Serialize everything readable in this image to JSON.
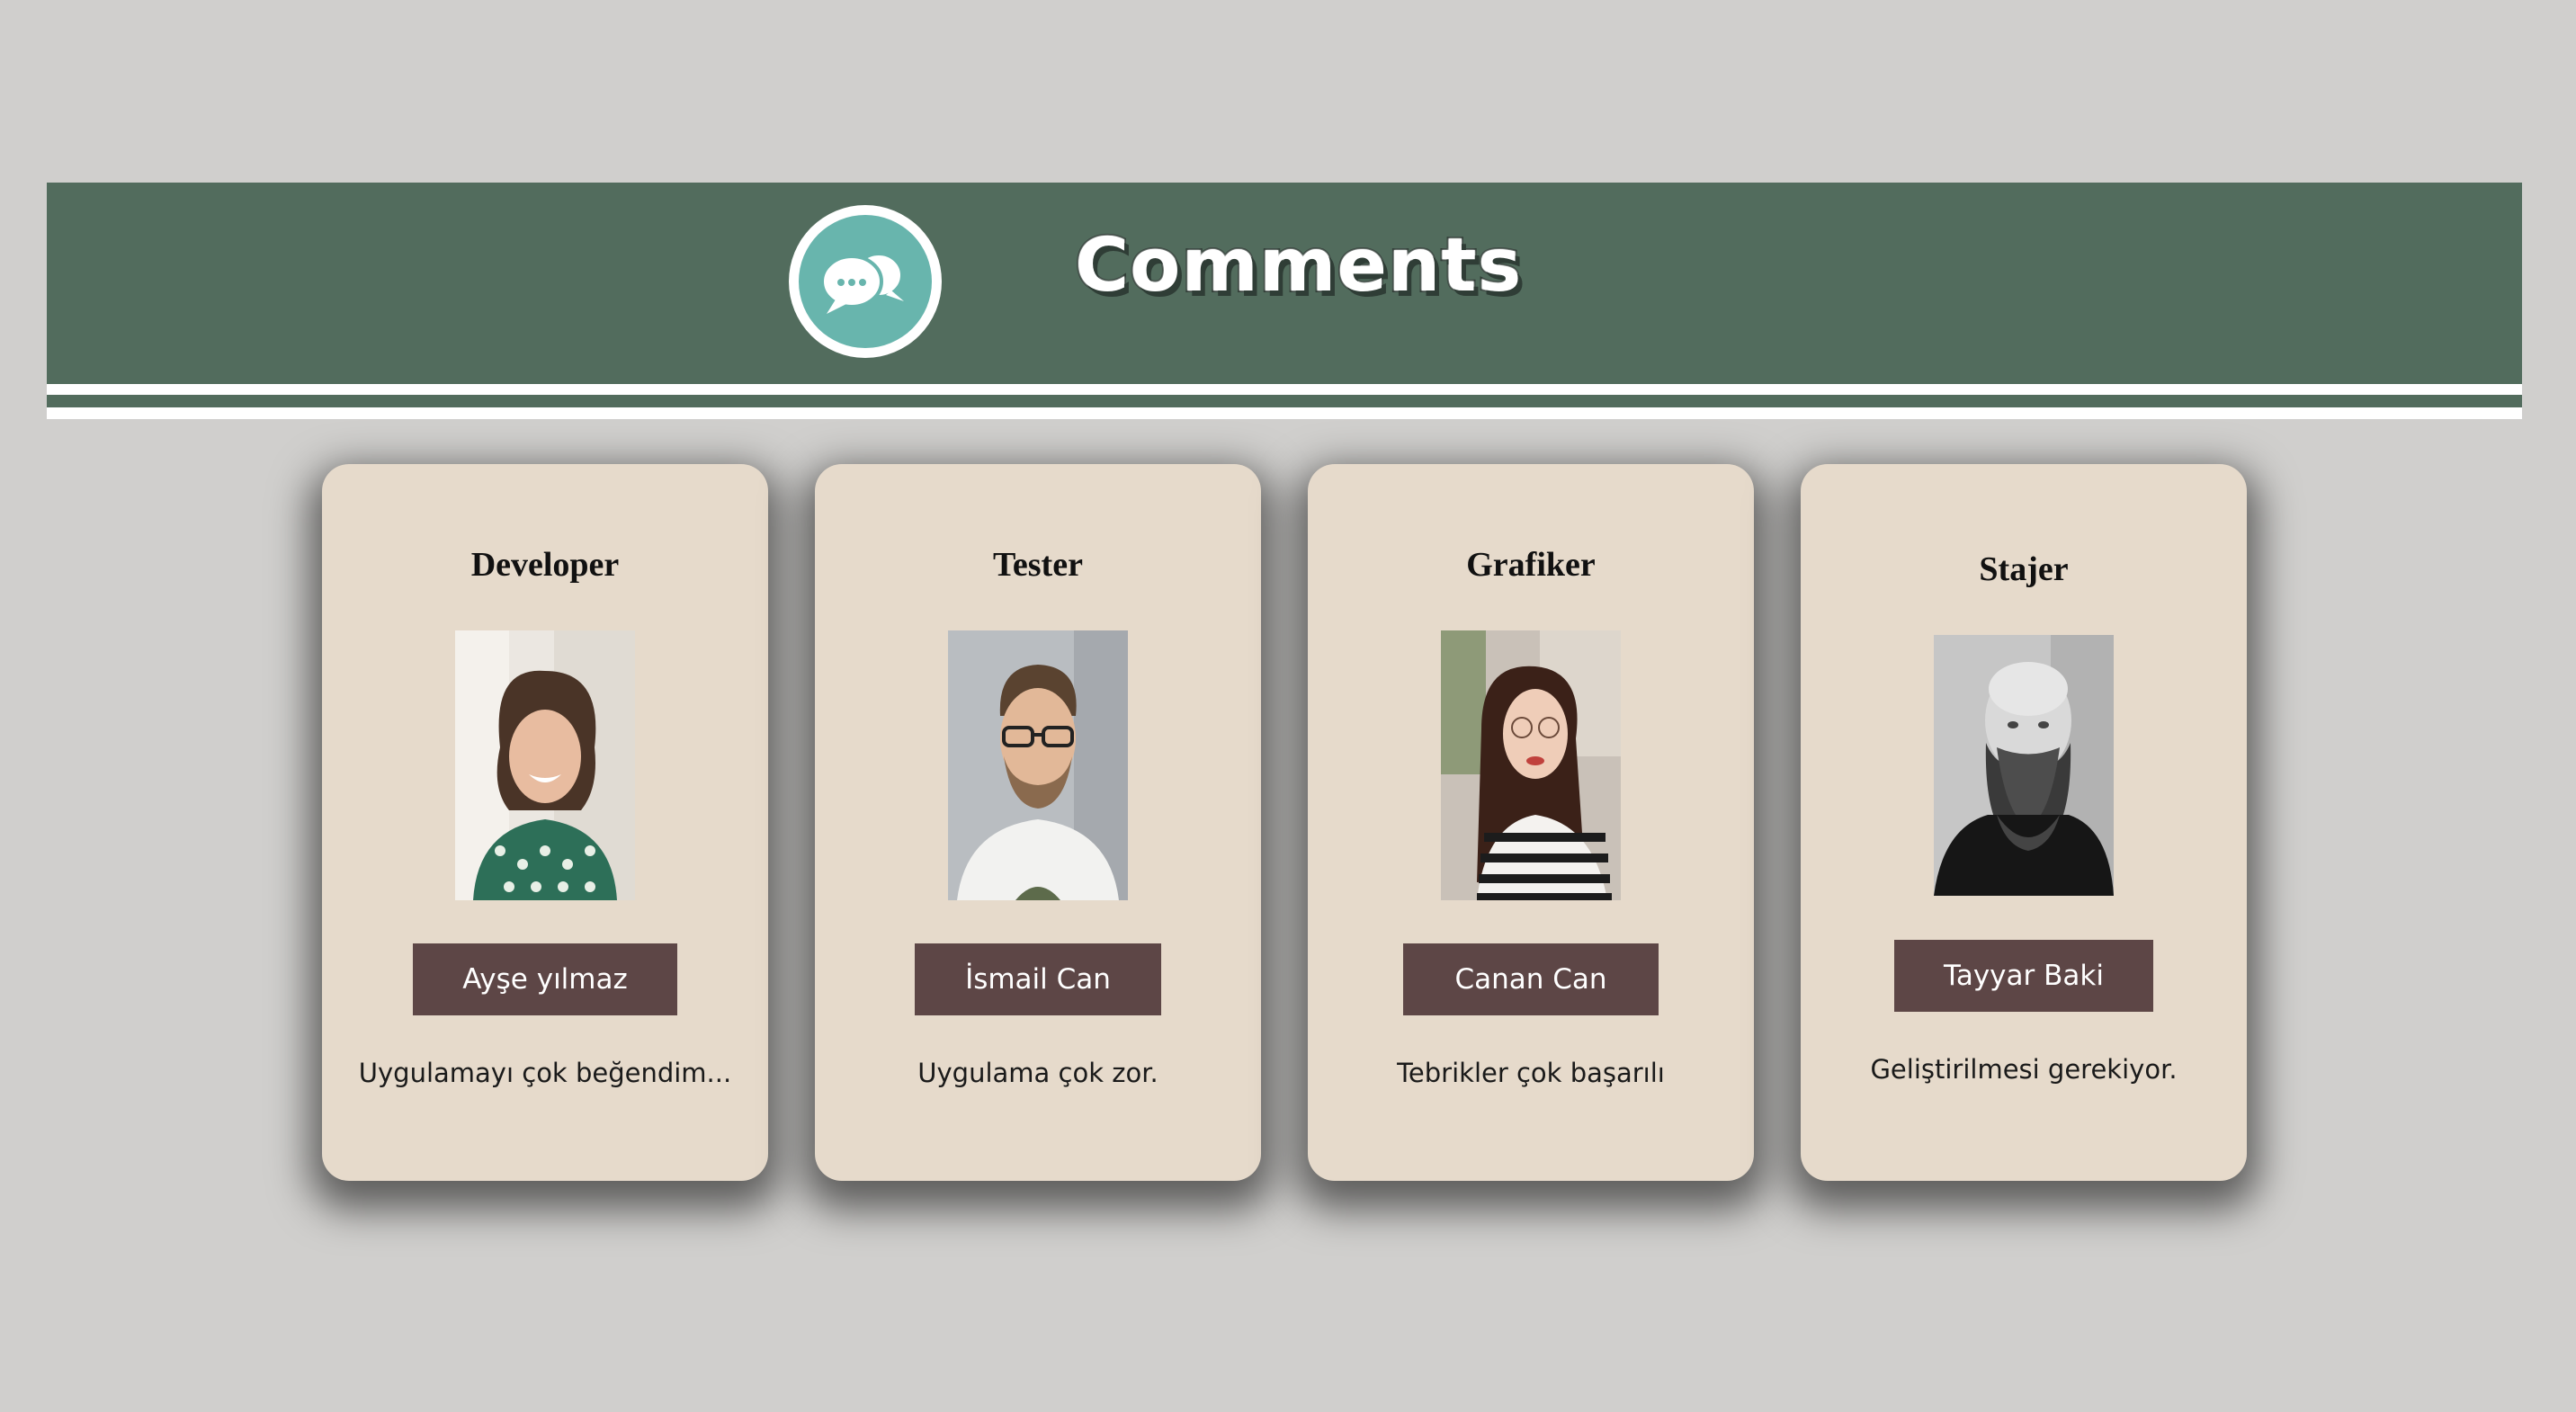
{
  "header": {
    "title": "Comments",
    "logo_icon": "speech-bubbles-icon",
    "background": "#526c5d",
    "logo_color": "#68b5ad"
  },
  "colors": {
    "page_background": "#d0cfcd",
    "card_background": "#e6dacb",
    "button_background": "#5d4646"
  },
  "cards": [
    {
      "role": "Developer",
      "name": "Ayşe yılmaz",
      "comment": "Uygulamayı çok beğendim..."
    },
    {
      "role": "Tester",
      "name": "İsmail Can",
      "comment": "Uygulama çok zor."
    },
    {
      "role": "Grafiker",
      "name": "Canan Can",
      "comment": "Tebrikler çok başarılı"
    },
    {
      "role": "Stajer",
      "name": "Tayyar Baki",
      "comment": "Geliştirilmesi gerekiyor."
    }
  ]
}
